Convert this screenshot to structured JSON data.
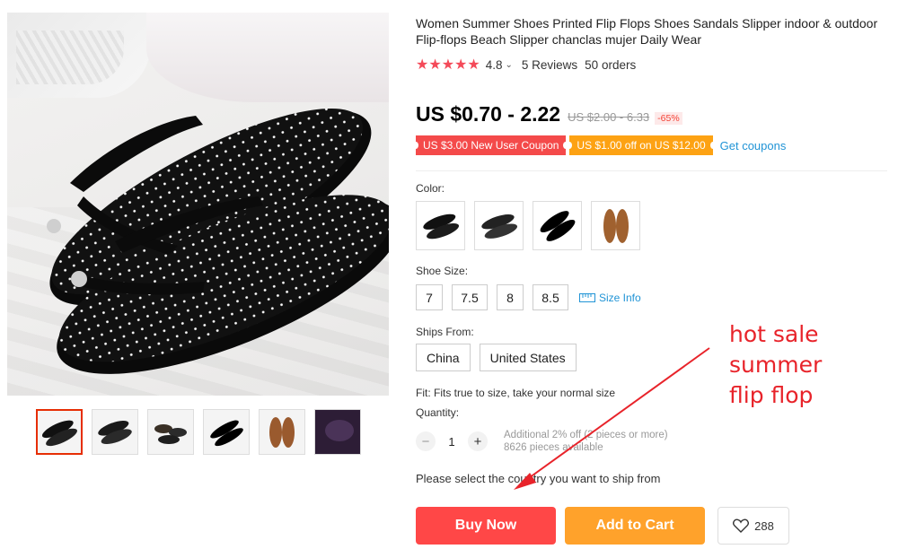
{
  "product": {
    "title": "Women Summer Shoes Printed Flip Flops Shoes Sandals Slipper indoor & outdoor Flip-flops Beach Slipper chanclas mujer Daily Wear",
    "rating": {
      "stars": "★★★★★",
      "score": "4.8",
      "reviews": "5 Reviews",
      "orders": "50 orders"
    },
    "price": "US $0.70 - 2.22",
    "original_price": "US $2.00 - 6.33",
    "discount": "-65%"
  },
  "coupons": {
    "new_user": "US $3.00 New User Coupon",
    "off": "US $1.00 off on US $12.00",
    "get_link": "Get coupons"
  },
  "options": {
    "color_label": "Color:",
    "size_label": "Shoe Size:",
    "sizes": [
      "7",
      "7.5",
      "8",
      "8.5"
    ],
    "size_info": "Size Info",
    "ships_from_label": "Ships From:",
    "ships_from": [
      "China",
      "United States"
    ],
    "fit": "Fit: Fits true to size, take your normal size",
    "quantity_label": "Quantity:",
    "quantity": "1",
    "quantity_note_1": "Additional 2% off (2 pieces or more)",
    "quantity_note_2": "8626 pieces available"
  },
  "ship_message": "Please select the country you want to ship from",
  "actions": {
    "buy_now": "Buy Now",
    "add_to_cart": "Add to Cart",
    "wishlist_count": "288"
  },
  "annotation": {
    "line1": "hot sale",
    "line2": "summer",
    "line3": "flip flop",
    "color": "#e8232a"
  },
  "colors": {
    "accent_red": "#ff4747",
    "accent_orange": "#ffa22b",
    "link_blue": "#2194d6",
    "star_red": "#f44a59"
  },
  "icons": {
    "heart": "heart-icon",
    "size_chart": "ruler-icon",
    "chevron": "chevron-down-icon"
  }
}
